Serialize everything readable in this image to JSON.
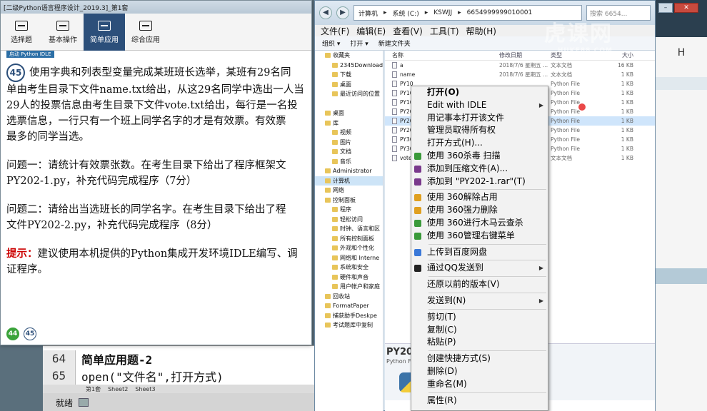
{
  "exam": {
    "title": "[二级Python语言程序设计_2019.3]_第1套",
    "toolbar": [
      "选择题",
      "基本操作",
      "简单应用",
      "综合应用"
    ],
    "active_tab": "简单应用",
    "subtab": "启动 Python IDLE",
    "question_number": "45",
    "lines": [
      "使用字典和列表型变量完成某班班长选举，某班有29名同",
      "单由考生目录下文件name.txt给出，从这29名同学中选出一人当",
      "29人的投票信息由考生目录下文件vote.txt给出，每行是一名投",
      "选票信息，一行只有一个班上同学名字的才是有效票。有效票",
      "最多的同学当选。",
      "问题一：请统计有效票张数。在考生目录下给出了程序框架文",
      "PY202-1.py，补充代码完成程序（7分）",
      "问题二：请给出当选班长的同学名字。在考生目录下给出了程",
      "文件PY202-2.py，补充代码完成程序（8分）"
    ],
    "hint_label": "提示：",
    "hint_text": "建议使用本机提供的Python集成开发环境IDLE编写、调",
    "hint_text2": "证程序。",
    "pager": [
      "44",
      "45"
    ]
  },
  "excel": {
    "rows": [
      {
        "num": "64",
        "text": "简单应用题-2"
      },
      {
        "num": "65",
        "text": "  open(\"文件名\",打开方式)"
      }
    ],
    "sheets": [
      "第1套",
      "Sheet2",
      "Sheet3"
    ],
    "status": "就绪"
  },
  "explorer": {
    "crumbs": [
      "计算机",
      "系统 (C:)",
      "KSWJJ",
      "6654999999010001"
    ],
    "search_placeholder": "搜索 6654...",
    "menu": [
      "文件(F)",
      "编辑(E)",
      "查看(V)",
      "工具(T)",
      "帮助(H)"
    ],
    "commands": [
      "组织 ▾",
      "打开 ▾",
      "新建文件夹"
    ],
    "nav": [
      {
        "label": "收藏夹",
        "lvl": 1
      },
      {
        "label": "2345Downloads",
        "lvl": 2
      },
      {
        "label": "下载",
        "lvl": 2
      },
      {
        "label": "桌面",
        "lvl": 2
      },
      {
        "label": "最近访问的位置",
        "lvl": 2
      },
      {
        "label": "",
        "lvl": 1
      },
      {
        "label": "桌面",
        "lvl": 1
      },
      {
        "label": "库",
        "lvl": 1
      },
      {
        "label": "视频",
        "lvl": 2
      },
      {
        "label": "图片",
        "lvl": 2
      },
      {
        "label": "文档",
        "lvl": 2
      },
      {
        "label": "音乐",
        "lvl": 2
      },
      {
        "label": "Administrator",
        "lvl": 1
      },
      {
        "label": "计算机",
        "lvl": 1,
        "sel": true
      },
      {
        "label": "网络",
        "lvl": 1
      },
      {
        "label": "控制面板",
        "lvl": 1
      },
      {
        "label": "程序",
        "lvl": 2
      },
      {
        "label": "轻松访问",
        "lvl": 2
      },
      {
        "label": "时钟、语言和区",
        "lvl": 2
      },
      {
        "label": "所有控制面板",
        "lvl": 2
      },
      {
        "label": "外观和个性化",
        "lvl": 2
      },
      {
        "label": "网络和 Interne",
        "lvl": 2
      },
      {
        "label": "系统和安全",
        "lvl": 2
      },
      {
        "label": "硬件和声音",
        "lvl": 2
      },
      {
        "label": "用户帐户和家庭",
        "lvl": 2
      },
      {
        "label": "回收站",
        "lvl": 1
      },
      {
        "label": "FormatPaper",
        "lvl": 1
      },
      {
        "label": "捕获助手Deskpe",
        "lvl": 1
      },
      {
        "label": "考试题库中复制",
        "lvl": 1
      }
    ],
    "columns": [
      "名称",
      "修改日期",
      "类型",
      "大小"
    ],
    "files": [
      {
        "name": "a",
        "date": "2018/7/6 星期五 ...",
        "type": "文本文档",
        "size": "16 KB"
      },
      {
        "name": "name",
        "date": "2018/7/6 星期五 ...",
        "type": "文本文档",
        "size": "1 KB"
      },
      {
        "name": "PY10",
        "date": "",
        "type": "Python File",
        "size": "1 KB"
      },
      {
        "name": "PY10",
        "date": "",
        "type": "Python File",
        "size": "1 KB"
      },
      {
        "name": "PY10",
        "date": "",
        "type": "Python File",
        "size": "1 KB"
      },
      {
        "name": "PY20",
        "date": "",
        "type": "Python File",
        "size": "1 KB"
      },
      {
        "name": "PY20",
        "date": "",
        "type": "Python File",
        "size": "1 KB",
        "sel": true
      },
      {
        "name": "PY20",
        "date": "",
        "type": "Python File",
        "size": "1 KB"
      },
      {
        "name": "PY30",
        "date": "",
        "type": "Python File",
        "size": "1 KB"
      },
      {
        "name": "PY30",
        "date": "",
        "type": "Python File",
        "size": "1 KB"
      },
      {
        "name": "vote",
        "date": "",
        "type": "文本文档",
        "size": "1 KB"
      }
    ],
    "preview_name": "PY202",
    "preview_type": "Python File"
  },
  "context_menu": [
    {
      "label": "打开(O)",
      "bold": true
    },
    {
      "label": "Edit with IDLE",
      "arrow": true
    },
    {
      "label": "用记事本打开该文件"
    },
    {
      "label": "管理员取得所有权"
    },
    {
      "label": "打开方式(H)..."
    },
    {
      "label": "使用 360杀毒 扫描",
      "icon": "#3a9a3a"
    },
    {
      "label": "添加到压缩文件(A)...",
      "icon": "#7a3a8c"
    },
    {
      "label": "添加到 \"PY202-1.rar\"(T)",
      "icon": "#7a3a8c"
    },
    {
      "sep": true
    },
    {
      "label": "使用 360解除占用",
      "icon": "#e0a020"
    },
    {
      "label": "使用 360强力删除",
      "icon": "#e0a020"
    },
    {
      "label": "使用 360进行木马云查杀",
      "icon": "#3a9a3a"
    },
    {
      "label": "使用 360管理右键菜单",
      "icon": "#3a9a3a"
    },
    {
      "sep": true
    },
    {
      "label": "上传到百度网盘",
      "icon": "#3a78d8"
    },
    {
      "sep": true
    },
    {
      "label": "通过QQ发送到",
      "icon": "#222222",
      "arrow": true
    },
    {
      "sep": true
    },
    {
      "label": "还原以前的版本(V)"
    },
    {
      "sep": true
    },
    {
      "label": "发送到(N)",
      "arrow": true
    },
    {
      "sep": true
    },
    {
      "label": "剪切(T)"
    },
    {
      "label": "复制(C)"
    },
    {
      "label": "粘贴(P)"
    },
    {
      "sep": true
    },
    {
      "label": "创建快捷方式(S)"
    },
    {
      "label": "删除(D)"
    },
    {
      "label": "重命名(M)"
    },
    {
      "sep": true
    },
    {
      "label": "属性(R)"
    }
  ],
  "right_panel": {
    "column_letter": "H"
  },
  "watermark": {
    "text": "虎课网",
    "sub": "HUKE88.COM"
  }
}
